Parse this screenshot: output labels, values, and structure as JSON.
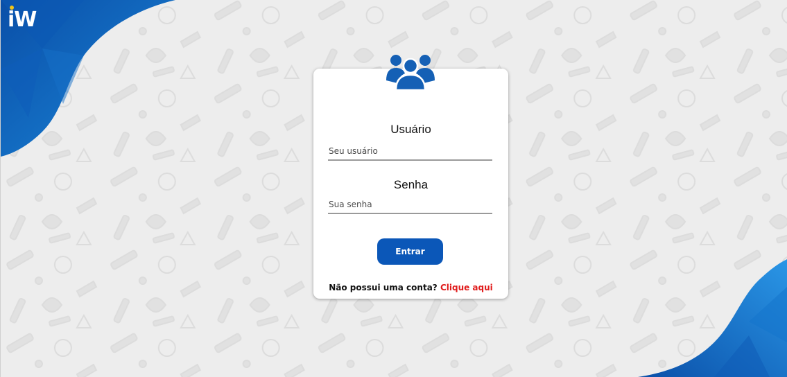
{
  "brand": {
    "logo_text": "iW",
    "accent_color": "#0b57b8",
    "link_color": "#e01b1b"
  },
  "login": {
    "icon": "users-group-icon",
    "username_label": "Usuário",
    "username_placeholder": "Seu usuário",
    "password_label": "Senha",
    "password_placeholder": "Sua senha",
    "submit_label": "Entrar",
    "signup_prompt": "Não possui uma conta?",
    "signup_link": "Clique aqui"
  }
}
